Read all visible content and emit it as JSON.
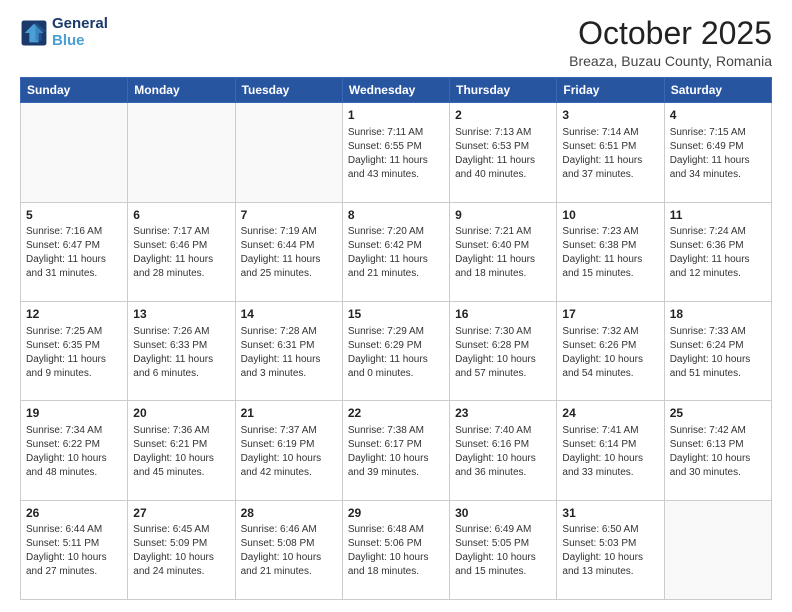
{
  "logo": {
    "line1": "General",
    "line2": "Blue"
  },
  "header": {
    "title": "October 2025",
    "subtitle": "Breaza, Buzau County, Romania"
  },
  "weekdays": [
    "Sunday",
    "Monday",
    "Tuesday",
    "Wednesday",
    "Thursday",
    "Friday",
    "Saturday"
  ],
  "weeks": [
    [
      {
        "day": "",
        "sunrise": "",
        "sunset": "",
        "daylight": ""
      },
      {
        "day": "",
        "sunrise": "",
        "sunset": "",
        "daylight": ""
      },
      {
        "day": "",
        "sunrise": "",
        "sunset": "",
        "daylight": ""
      },
      {
        "day": "1",
        "sunrise": "Sunrise: 7:11 AM",
        "sunset": "Sunset: 6:55 PM",
        "daylight": "Daylight: 11 hours and 43 minutes."
      },
      {
        "day": "2",
        "sunrise": "Sunrise: 7:13 AM",
        "sunset": "Sunset: 6:53 PM",
        "daylight": "Daylight: 11 hours and 40 minutes."
      },
      {
        "day": "3",
        "sunrise": "Sunrise: 7:14 AM",
        "sunset": "Sunset: 6:51 PM",
        "daylight": "Daylight: 11 hours and 37 minutes."
      },
      {
        "day": "4",
        "sunrise": "Sunrise: 7:15 AM",
        "sunset": "Sunset: 6:49 PM",
        "daylight": "Daylight: 11 hours and 34 minutes."
      }
    ],
    [
      {
        "day": "5",
        "sunrise": "Sunrise: 7:16 AM",
        "sunset": "Sunset: 6:47 PM",
        "daylight": "Daylight: 11 hours and 31 minutes."
      },
      {
        "day": "6",
        "sunrise": "Sunrise: 7:17 AM",
        "sunset": "Sunset: 6:46 PM",
        "daylight": "Daylight: 11 hours and 28 minutes."
      },
      {
        "day": "7",
        "sunrise": "Sunrise: 7:19 AM",
        "sunset": "Sunset: 6:44 PM",
        "daylight": "Daylight: 11 hours and 25 minutes."
      },
      {
        "day": "8",
        "sunrise": "Sunrise: 7:20 AM",
        "sunset": "Sunset: 6:42 PM",
        "daylight": "Daylight: 11 hours and 21 minutes."
      },
      {
        "day": "9",
        "sunrise": "Sunrise: 7:21 AM",
        "sunset": "Sunset: 6:40 PM",
        "daylight": "Daylight: 11 hours and 18 minutes."
      },
      {
        "day": "10",
        "sunrise": "Sunrise: 7:23 AM",
        "sunset": "Sunset: 6:38 PM",
        "daylight": "Daylight: 11 hours and 15 minutes."
      },
      {
        "day": "11",
        "sunrise": "Sunrise: 7:24 AM",
        "sunset": "Sunset: 6:36 PM",
        "daylight": "Daylight: 11 hours and 12 minutes."
      }
    ],
    [
      {
        "day": "12",
        "sunrise": "Sunrise: 7:25 AM",
        "sunset": "Sunset: 6:35 PM",
        "daylight": "Daylight: 11 hours and 9 minutes."
      },
      {
        "day": "13",
        "sunrise": "Sunrise: 7:26 AM",
        "sunset": "Sunset: 6:33 PM",
        "daylight": "Daylight: 11 hours and 6 minutes."
      },
      {
        "day": "14",
        "sunrise": "Sunrise: 7:28 AM",
        "sunset": "Sunset: 6:31 PM",
        "daylight": "Daylight: 11 hours and 3 minutes."
      },
      {
        "day": "15",
        "sunrise": "Sunrise: 7:29 AM",
        "sunset": "Sunset: 6:29 PM",
        "daylight": "Daylight: 11 hours and 0 minutes."
      },
      {
        "day": "16",
        "sunrise": "Sunrise: 7:30 AM",
        "sunset": "Sunset: 6:28 PM",
        "daylight": "Daylight: 10 hours and 57 minutes."
      },
      {
        "day": "17",
        "sunrise": "Sunrise: 7:32 AM",
        "sunset": "Sunset: 6:26 PM",
        "daylight": "Daylight: 10 hours and 54 minutes."
      },
      {
        "day": "18",
        "sunrise": "Sunrise: 7:33 AM",
        "sunset": "Sunset: 6:24 PM",
        "daylight": "Daylight: 10 hours and 51 minutes."
      }
    ],
    [
      {
        "day": "19",
        "sunrise": "Sunrise: 7:34 AM",
        "sunset": "Sunset: 6:22 PM",
        "daylight": "Daylight: 10 hours and 48 minutes."
      },
      {
        "day": "20",
        "sunrise": "Sunrise: 7:36 AM",
        "sunset": "Sunset: 6:21 PM",
        "daylight": "Daylight: 10 hours and 45 minutes."
      },
      {
        "day": "21",
        "sunrise": "Sunrise: 7:37 AM",
        "sunset": "Sunset: 6:19 PM",
        "daylight": "Daylight: 10 hours and 42 minutes."
      },
      {
        "day": "22",
        "sunrise": "Sunrise: 7:38 AM",
        "sunset": "Sunset: 6:17 PM",
        "daylight": "Daylight: 10 hours and 39 minutes."
      },
      {
        "day": "23",
        "sunrise": "Sunrise: 7:40 AM",
        "sunset": "Sunset: 6:16 PM",
        "daylight": "Daylight: 10 hours and 36 minutes."
      },
      {
        "day": "24",
        "sunrise": "Sunrise: 7:41 AM",
        "sunset": "Sunset: 6:14 PM",
        "daylight": "Daylight: 10 hours and 33 minutes."
      },
      {
        "day": "25",
        "sunrise": "Sunrise: 7:42 AM",
        "sunset": "Sunset: 6:13 PM",
        "daylight": "Daylight: 10 hours and 30 minutes."
      }
    ],
    [
      {
        "day": "26",
        "sunrise": "Sunrise: 6:44 AM",
        "sunset": "Sunset: 5:11 PM",
        "daylight": "Daylight: 10 hours and 27 minutes."
      },
      {
        "day": "27",
        "sunrise": "Sunrise: 6:45 AM",
        "sunset": "Sunset: 5:09 PM",
        "daylight": "Daylight: 10 hours and 24 minutes."
      },
      {
        "day": "28",
        "sunrise": "Sunrise: 6:46 AM",
        "sunset": "Sunset: 5:08 PM",
        "daylight": "Daylight: 10 hours and 21 minutes."
      },
      {
        "day": "29",
        "sunrise": "Sunrise: 6:48 AM",
        "sunset": "Sunset: 5:06 PM",
        "daylight": "Daylight: 10 hours and 18 minutes."
      },
      {
        "day": "30",
        "sunrise": "Sunrise: 6:49 AM",
        "sunset": "Sunset: 5:05 PM",
        "daylight": "Daylight: 10 hours and 15 minutes."
      },
      {
        "day": "31",
        "sunrise": "Sunrise: 6:50 AM",
        "sunset": "Sunset: 5:03 PM",
        "daylight": "Daylight: 10 hours and 13 minutes."
      },
      {
        "day": "",
        "sunrise": "",
        "sunset": "",
        "daylight": ""
      }
    ]
  ]
}
